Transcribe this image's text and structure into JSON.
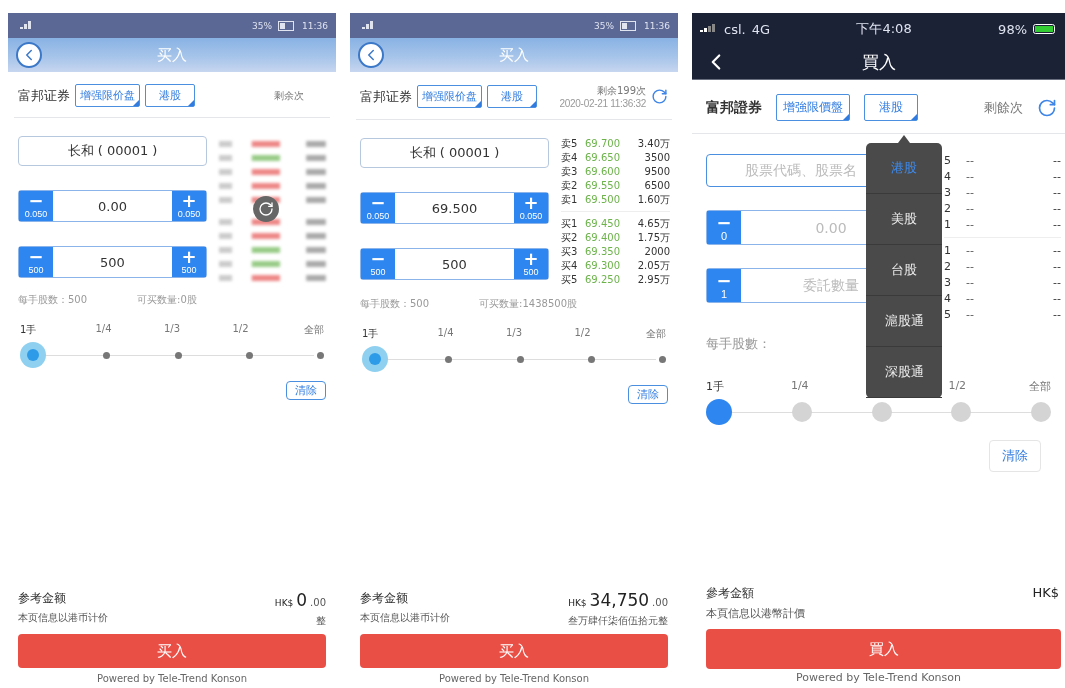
{
  "phones": [
    {
      "kind": "android",
      "status": {
        "battery": "35%",
        "time": "11:36"
      },
      "title": "买入",
      "broker": "富邦证券",
      "order_type": "增强限价盘",
      "market": "港股",
      "remaining": "剩余次",
      "refresh_in_header": false,
      "stock": {
        "value": "长和 ( 00001 )"
      },
      "price": {
        "minus": "−",
        "minus_step": "0.050",
        "plus": "+",
        "plus_step": "0.050",
        "value": "0.00"
      },
      "quantity": {
        "minus": "−",
        "minus_step": "500",
        "plus": "+",
        "plus_step": "500",
        "value": "500"
      },
      "book": {
        "kind": "blurred"
      },
      "lot_size": "每手股数：500",
      "buyable": "可买数量:0股",
      "stops": [
        {
          "label": "1手",
          "selected": true
        },
        {
          "label": "1/4",
          "selected": false
        },
        {
          "label": "1/3",
          "selected": false
        },
        {
          "label": "1/2",
          "selected": false
        },
        {
          "label": "全部",
          "selected": false
        }
      ],
      "clear": "清除",
      "amount_label": "参考金额",
      "currency": "HK$",
      "amount": "0",
      "decimals": ".00",
      "amount_words": "整",
      "note": "本页信息以港币计价",
      "buy": "买入",
      "footer": "Powered by Tele-Trend Konson"
    },
    {
      "kind": "android",
      "status": {
        "battery": "35%",
        "time": "11:36"
      },
      "title": "买入",
      "broker": "富邦证券",
      "order_type": "增强限价盘",
      "market": "港股",
      "remaining": "剩余199次",
      "timestamp": "2020-02-21 11:36:32",
      "refresh_in_header": true,
      "stock": {
        "value": "长和 ( 00001 )"
      },
      "price": {
        "minus": "−",
        "minus_step": "0.050",
        "plus": "+",
        "plus_step": "0.050",
        "value": "69.500"
      },
      "quantity": {
        "minus": "−",
        "minus_step": "500",
        "plus": "+",
        "plus_step": "500",
        "value": "500"
      },
      "book": {
        "kind": "levels",
        "asks": [
          {
            "label": "卖5",
            "price": "69.700",
            "volume": "3.40万"
          },
          {
            "label": "卖4",
            "price": "69.650",
            "volume": "3500"
          },
          {
            "label": "卖3",
            "price": "69.600",
            "volume": "9500"
          },
          {
            "label": "卖2",
            "price": "69.550",
            "volume": "6500"
          },
          {
            "label": "卖1",
            "price": "69.500",
            "volume": "1.60万"
          }
        ],
        "bids": [
          {
            "label": "买1",
            "price": "69.450",
            "volume": "4.65万"
          },
          {
            "label": "买2",
            "price": "69.400",
            "volume": "1.75万"
          },
          {
            "label": "买3",
            "price": "69.350",
            "volume": "2000"
          },
          {
            "label": "买4",
            "price": "69.300",
            "volume": "2.05万"
          },
          {
            "label": "买5",
            "price": "69.250",
            "volume": "2.95万"
          }
        ]
      },
      "lot_size": "每手股数：500",
      "buyable": "可买数量:1438500股",
      "stops": [
        {
          "label": "1手",
          "selected": true
        },
        {
          "label": "1/4",
          "selected": false
        },
        {
          "label": "1/3",
          "selected": false
        },
        {
          "label": "1/2",
          "selected": false
        },
        {
          "label": "全部",
          "selected": false
        }
      ],
      "clear": "清除",
      "amount_label": "参考金额",
      "currency": "HK$",
      "amount": "34,750",
      "decimals": ".00",
      "amount_words": "叁万肆仟柒佰伍拾元整",
      "note": "本页信息以港币计价",
      "buy": "买入",
      "footer": "Powered by Tele-Trend Konson"
    },
    {
      "kind": "ios",
      "status": {
        "carrier": "csl.",
        "network": "4G",
        "time": "下午4:08",
        "battery": "98%"
      },
      "title": "買入",
      "broker": "富邦證券",
      "order_type": "增強限價盤",
      "market": "港股",
      "remaining": "剩餘次",
      "refresh_in_header": true,
      "stock": {
        "placeholder": "股票代碼、股票名"
      },
      "price": {
        "minus": "−",
        "minus_step": "0",
        "placeholder": "0.00"
      },
      "quantity": {
        "minus": "−",
        "minus_step": "1",
        "placeholder": "委託數量"
      },
      "book": {
        "kind": "levels",
        "asks": [
          {
            "label": "5",
            "price": "--",
            "volume": "--"
          },
          {
            "label": "4",
            "price": "--",
            "volume": "--"
          },
          {
            "label": "3",
            "price": "--",
            "volume": "--"
          },
          {
            "label": "2",
            "price": "--",
            "volume": "--"
          },
          {
            "label": "1",
            "price": "--",
            "volume": "--"
          }
        ],
        "bids": [
          {
            "label": "1",
            "price": "--",
            "volume": "--"
          },
          {
            "label": "2",
            "price": "--",
            "volume": "--"
          },
          {
            "label": "3",
            "price": "--",
            "volume": "--"
          },
          {
            "label": "4",
            "price": "--",
            "volume": "--"
          },
          {
            "label": "5",
            "price": "--",
            "volume": "--"
          }
        ]
      },
      "lot_size": "每手股數：",
      "stops": [
        {
          "label": "1手",
          "selected": true
        },
        {
          "label": "1/4",
          "selected": false
        },
        {
          "selected": false
        },
        {
          "label": "1/2",
          "selected": false
        },
        {
          "label": "全部",
          "selected": false
        }
      ],
      "clear": "清除",
      "amount_label": "參考金額",
      "currency": "HK$",
      "note": "本頁信息以港幣計價",
      "buy": "買入",
      "footer": "Powered by Tele-Trend Konson",
      "dropdown": {
        "items": [
          {
            "label": "港股",
            "selected": true
          },
          {
            "label": "美股",
            "selected": false
          },
          {
            "label": "台股",
            "selected": false
          },
          {
            "label": "滬股通",
            "selected": false
          },
          {
            "label": "深股通",
            "selected": false
          }
        ]
      }
    }
  ]
}
